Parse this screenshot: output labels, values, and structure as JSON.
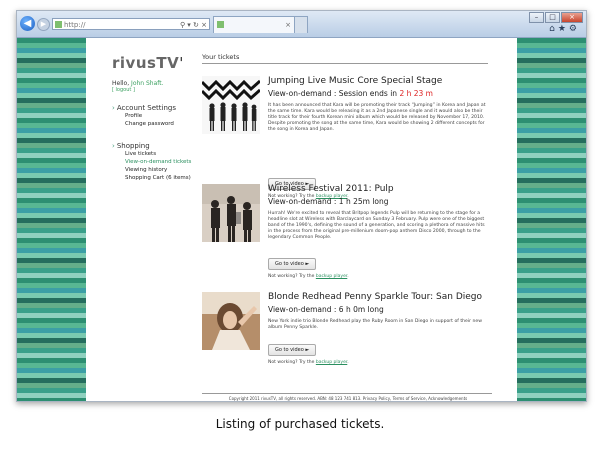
{
  "browser": {
    "address": "http://",
    "tab_label": "",
    "colors": {
      "chrome": "#c9d8ea",
      "stripe_green": "#2d8f72"
    }
  },
  "site": {
    "logo": "rivusTV",
    "logo_mark": "'",
    "hello_prefix": "Hello,",
    "user_name": "John Shaft.",
    "logout": "[ logout ]"
  },
  "nav": {
    "account": {
      "heading": "Account Settings",
      "items": [
        "Profile",
        "Change password"
      ]
    },
    "shopping": {
      "heading": "Shopping",
      "items": [
        "Live tickets",
        "View-on-demand tickets",
        "Viewing history",
        "Shopping Cart (6 items)"
      ],
      "active_index": 1
    }
  },
  "main": {
    "heading": "Your tickets",
    "broken_prefix": "Not working? Try the",
    "broken_link": "backup player",
    "broken_suffix": ".",
    "go_label": "Go to video ►",
    "tickets": [
      {
        "title": "Jumping Live Music Core Special Stage",
        "subtitle_prefix": "View-on-demand : Session ends in",
        "subtitle_value": "2 h 23 m",
        "desc": "It has been announced that Kara will be promoting their track “Jumping” in Korea and Japan at the same time. Kara would be releasing it as a 2nd Japanese single and it would also be their title track for their fourth Korean mini album which would be released by November 17, 2010. Despite promoting the song at the same time, Kara would be showing 2 different concepts for the song in Korea and Japan."
      },
      {
        "title": "Wireless Festival 2011: Pulp",
        "subtitle_prefix": "View-on-demand :",
        "subtitle_value": "1 h 25m long",
        "desc": "Hurrah! We're excited to reveal that Britpop legends Pulp will be returning to the stage for a headline slot at Wireless with Barclaycard on Sunday 3 February. Pulp were one of the biggest band of the 1990's, defining the sound of a generation, and scoring a plethora of massive hits in the process from the original pre-millenium doom-pop anthem Disco 2000, through to the legendary Common People."
      },
      {
        "title": "Blonde Redhead Penny Sparkle Tour: San Diego",
        "subtitle_prefix": "View-on-demand :",
        "subtitle_value": "6 h 0m long",
        "desc": "New York indie trio Blonde Redhead play the Ruby Room in San Diego in support of their new album Penny Sparkle."
      }
    ]
  },
  "footer": {
    "copyright": "Copyright 2011 rivusTV, all rights reserved. ABN: 48 123 741 813.",
    "links": [
      "Privacy Policy",
      "Terms of Service",
      "Acknowledgements"
    ]
  },
  "caption": "Listing of purchased tickets."
}
